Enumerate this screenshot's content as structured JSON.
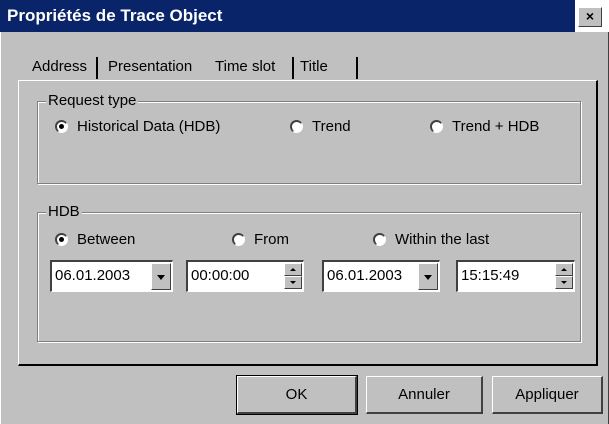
{
  "window": {
    "title": "Propriétés de Trace Object",
    "close_label": "×"
  },
  "tabs": [
    {
      "label": "Address",
      "active": false
    },
    {
      "label": "Presentation",
      "active": false
    },
    {
      "label": "Time slot",
      "active": true
    },
    {
      "label": "Title",
      "active": false
    }
  ],
  "request_type": {
    "label": "Request type",
    "options": [
      {
        "label": "Historical Data (HDB)",
        "checked": true
      },
      {
        "label": "Trend",
        "checked": false
      },
      {
        "label": "Trend + HDB",
        "checked": false
      }
    ]
  },
  "hdb": {
    "label": "HDB",
    "options": [
      {
        "label": "Between",
        "checked": true
      },
      {
        "label": "From",
        "checked": false
      },
      {
        "label": "Within the last",
        "checked": false
      }
    ],
    "start_date": "06.01.2003",
    "start_time": "00:00:00",
    "end_date": "06.01.2003",
    "end_time": "15:15:49"
  },
  "buttons": {
    "ok": "OK",
    "cancel": "Annuler",
    "apply": "Appliquer"
  },
  "colors": {
    "title_bar": "#0a246a",
    "face": "#c0c0c0"
  }
}
